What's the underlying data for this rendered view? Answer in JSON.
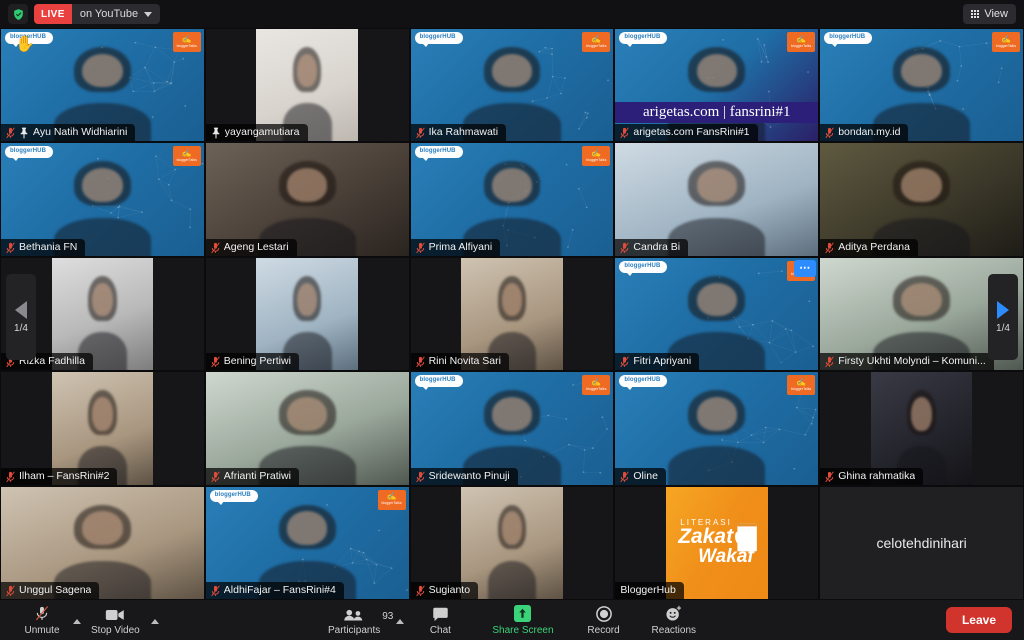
{
  "topbar": {
    "shield_icon": "shield-check-icon",
    "live_badge": "LIVE",
    "platform": "on YouTube",
    "platform_caret": "chevron-down-icon",
    "view_label": "View",
    "view_icon": "grid-icon"
  },
  "pager": {
    "left_icon": "chevron-left-icon",
    "left_label": "1/4",
    "right_icon": "chevron-right-icon",
    "right_label": "1/4"
  },
  "gallery": {
    "rows": [
      [
        {
          "name": "Ayu Natih Widhiarini",
          "muted": true,
          "pinned": true,
          "bg": "vbg-blue",
          "bloggerhub": true,
          "raise_hand": true,
          "pillar": false
        },
        {
          "name": "yayangamutiara",
          "muted": false,
          "pinned": true,
          "bg": "vbg-wall",
          "bloggerhub": false,
          "pillar": true
        },
        {
          "name": "Ika Rahmawati",
          "muted": true,
          "pinned": false,
          "bg": "vbg-blue",
          "bloggerhub": true,
          "pillar": false
        },
        {
          "name": "arigetas.com FansRini#1",
          "muted": true,
          "pinned": false,
          "bg": "vbg-purple",
          "bloggerhub": true,
          "banner": "arigetas.com | fansrini#1",
          "pillar": false
        },
        {
          "name": "bondan.my.id",
          "muted": true,
          "pinned": false,
          "bg": "vbg-blue",
          "bloggerhub": true,
          "pillar": false
        }
      ],
      [
        {
          "name": "Bethania FN",
          "muted": true,
          "pinned": false,
          "bg": "vbg-blue",
          "bloggerhub": true,
          "pillar": false
        },
        {
          "name": "Ageng Lestari",
          "muted": true,
          "pinned": false,
          "bg": "vbg-room",
          "bloggerhub": false,
          "pillar": false
        },
        {
          "name": "Prima Alfiyani",
          "muted": true,
          "pinned": false,
          "bg": "vbg-blue",
          "bloggerhub": true,
          "pillar": false
        },
        {
          "name": "Candra Bi",
          "muted": true,
          "pinned": false,
          "bg": "vbg-cool",
          "bloggerhub": false,
          "pillar": false
        },
        {
          "name": "Aditya Perdana",
          "muted": true,
          "pinned": false,
          "bg": "vbg-dim",
          "bloggerhub": false,
          "pillar": false
        }
      ],
      [
        {
          "name": "Rizka Fadhilla",
          "muted": true,
          "pinned": false,
          "bg": "vbg-grey",
          "bloggerhub": false,
          "pillar": true
        },
        {
          "name": "Bening Pertiwi",
          "muted": true,
          "pinned": false,
          "bg": "vbg-cool",
          "bloggerhub": false,
          "pillar": true
        },
        {
          "name": "Rini Novita Sari",
          "muted": true,
          "pinned": false,
          "bg": "vbg-warm",
          "bloggerhub": false,
          "pillar": true
        },
        {
          "name": "Fitri Apriyani",
          "muted": true,
          "pinned": false,
          "bg": "vbg-blue",
          "bloggerhub": true,
          "more": true,
          "pillar": false
        },
        {
          "name": "Firsty Ukhti Molyndi – Komuni...",
          "muted": true,
          "pinned": false,
          "bg": "vbg-teal",
          "bloggerhub": false,
          "pillar": false
        }
      ],
      [
        {
          "name": "Ilham – FansRini#2",
          "muted": true,
          "pinned": false,
          "bg": "vbg-warm",
          "bloggerhub": false,
          "pillar": true
        },
        {
          "name": "Afrianti Pratiwi",
          "muted": true,
          "pinned": false,
          "bg": "vbg-teal",
          "bloggerhub": false,
          "pillar": false
        },
        {
          "name": "Sridewanto Pinuji",
          "muted": true,
          "pinned": false,
          "bg": "vbg-blue",
          "bloggerhub": true,
          "pillar": false
        },
        {
          "name": "Oline",
          "muted": true,
          "pinned": false,
          "bg": "vbg-blue",
          "bloggerhub": true,
          "pillar": false
        },
        {
          "name": "Ghina rahmatika",
          "muted": true,
          "pinned": false,
          "bg": "vbg-night",
          "bloggerhub": false,
          "pillar": true
        }
      ],
      [
        {
          "name": "Unggul Sagena",
          "muted": true,
          "pinned": false,
          "bg": "vbg-warm",
          "bloggerhub": false,
          "pillar": false
        },
        {
          "name": "AldhiFajar – FansRini#4",
          "muted": true,
          "pinned": false,
          "bg": "vbg-blue",
          "bloggerhub": true,
          "pillar": false
        },
        {
          "name": "Sugianto",
          "muted": true,
          "pinned": false,
          "bg": "vbg-warm",
          "bloggerhub": false,
          "pillar": true
        },
        {
          "name": "BloggerHub",
          "muted": false,
          "pinned": false,
          "bg": "vbg-orange",
          "bloggerhub": false,
          "speaking": true,
          "pillar": true,
          "poster": {
            "line1": "LITERASI",
            "line2": "Zakat",
            "line3": "Wakaf"
          }
        },
        {
          "name": "celotehdinihari",
          "muted": false,
          "pinned": false,
          "name_only": true
        }
      ]
    ]
  },
  "toolbar": {
    "mute": {
      "label": "Unmute",
      "icon": "microphone-muted-icon"
    },
    "video": {
      "label": "Stop Video",
      "icon": "video-camera-icon"
    },
    "participants": {
      "label": "Participants",
      "icon": "people-icon",
      "count": "93"
    },
    "chat": {
      "label": "Chat",
      "icon": "chat-bubble-icon"
    },
    "share": {
      "label": "Share Screen",
      "icon": "share-screen-icon"
    },
    "record": {
      "label": "Record",
      "icon": "record-circle-icon"
    },
    "reactions": {
      "label": "Reactions",
      "icon": "smiley-reactions-icon"
    },
    "leave": {
      "label": "Leave"
    }
  }
}
